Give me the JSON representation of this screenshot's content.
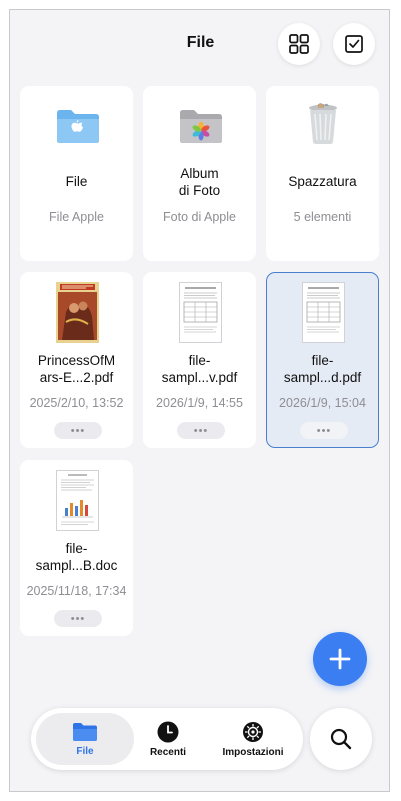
{
  "header": {
    "title": "File"
  },
  "top_actions": {
    "grid_icon": "grid-view-icon",
    "select_icon": "checkbox-select-icon"
  },
  "locations": [
    {
      "name": "File",
      "subtitle": "File Apple",
      "icon": "folder-icloud-icon"
    },
    {
      "name": "Album\ndi Foto",
      "subtitle": "Foto di Apple",
      "icon": "photos-folder-icon"
    },
    {
      "name": "Spazzatura",
      "subtitle": "5 elementi",
      "icon": "trash-icon"
    }
  ],
  "files": [
    {
      "name": "PrincessOfM\nars-E...2.pdf",
      "date": "2025/2/10, 13:52",
      "more": "•••",
      "selected": false,
      "thumbnail": "book-cover-thumbnail"
    },
    {
      "name": "file-\nsampl...v.pdf",
      "date": "2026/1/9, 14:55",
      "more": "•••",
      "selected": false,
      "thumbnail": "document-table-thumbnail"
    },
    {
      "name": "file-\nsampl...d.pdf",
      "date": "2026/1/9, 15:04",
      "more": "•••",
      "selected": true,
      "thumbnail": "document-table-thumbnail"
    },
    {
      "name": "file-\nsampl...B.doc",
      "date": "2025/11/18, 17:34",
      "more": "•••",
      "selected": false,
      "thumbnail": "document-chart-thumbnail"
    }
  ],
  "fab": {
    "icon": "plus-icon"
  },
  "tabbar": {
    "tabs": [
      {
        "label": "File",
        "icon": "folder-icon",
        "active": true
      },
      {
        "label": "Recenti",
        "icon": "clock-icon",
        "active": false
      },
      {
        "label": "Impostazioni",
        "icon": "gear-icon",
        "active": false
      }
    ],
    "search_icon": "search-icon"
  },
  "colors": {
    "accent": "#3a7ef2",
    "selected_border": "#4a7fd0",
    "selected_bg": "#e5ebf5",
    "background": "#f4f4f6"
  }
}
